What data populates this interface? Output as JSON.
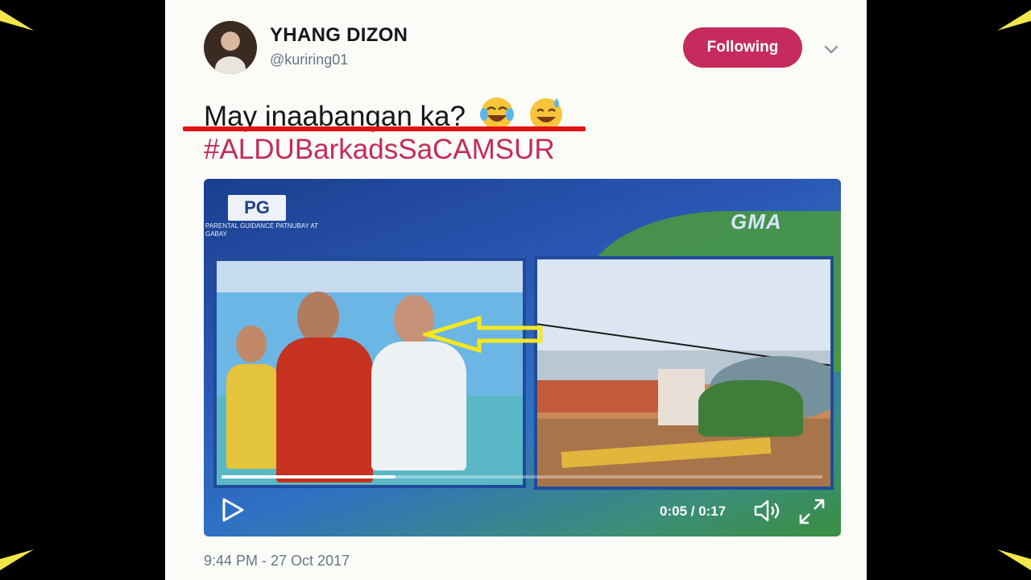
{
  "tweet": {
    "author_name": "YHANG DIZON",
    "handle": "@kuriring01",
    "follow_label": "Following",
    "text": "May inaabangan ka?",
    "hashtag": "#ALDUBarkadsSaCAMSUR",
    "timestamp": "9:44 PM - 27 Oct 2017"
  },
  "video": {
    "rating_badge": "PG",
    "rating_caption": "PARENTAL GUIDANCE PATNUBAY AT GABAY",
    "channel_logo": "GMA",
    "current_time": "0:05",
    "duration": "0:17",
    "time_display": "0:05 / 0:17",
    "progress_fraction": 0.29
  },
  "icons": {
    "dropdown": "chevron-down-icon",
    "emoji_1": "face-with-tears-of-joy-icon",
    "emoji_2": "grinning-face-with-sweat-icon",
    "play": "play-icon",
    "volume": "volume-icon",
    "fullscreen": "fullscreen-icon"
  },
  "colors": {
    "follow_button": "#c52b5c",
    "hashtag": "#c52b5c",
    "underline": "#e01212",
    "annotation_arrow": "#f5e81e",
    "corner_accent": "#f2e64a"
  }
}
